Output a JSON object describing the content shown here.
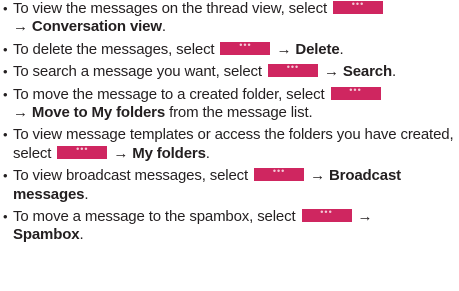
{
  "colors": {
    "text": "#231f20",
    "menu_button": "#cf2660"
  },
  "menu_button": {
    "icon": "more-options-icon",
    "glyph": "•••"
  },
  "arrow": "→",
  "bullet": "•",
  "items": [
    {
      "pre": "To view the messages on the thread view, select",
      "target": "Conversation view",
      "post": "."
    },
    {
      "pre": "To delete the messages, select",
      "target": "Delete",
      "post": "."
    },
    {
      "pre": "To search a message you want, select",
      "target": "Search",
      "post": "."
    },
    {
      "pre": "To move the message to a created folder, select",
      "target": "Move to My folders",
      "post": " from the message list."
    },
    {
      "pre": "To view message templates or access the folders you have created, select",
      "target": "My folders",
      "post": "."
    },
    {
      "pre": "To view broadcast messages, select",
      "target": "Broadcast messages",
      "post": "."
    },
    {
      "pre": "To move a message to the spambox, select",
      "target": "Spambox",
      "post": "."
    }
  ]
}
